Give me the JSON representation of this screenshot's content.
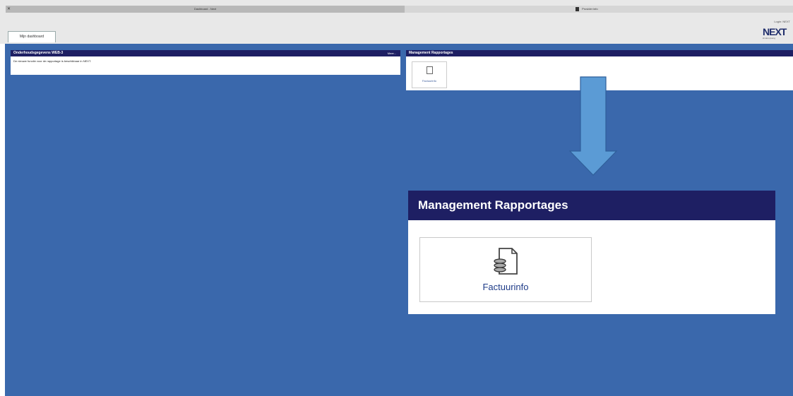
{
  "browser": {
    "active_tab_title": "Dashboard - Next",
    "close_label": "✕",
    "provider_label": "Provider info"
  },
  "header": {
    "user_info": "Login: NEXT",
    "dashboard_tab_label": "Mijn dashboard",
    "logo_text": "NEXT",
    "logo_subtitle": "kinderopvang"
  },
  "panel_left": {
    "title": "Onderhoudsgegevens WEB-3",
    "more_label": "Meer...",
    "message": "De nieuwe functie voor de rapportage is beschikbaar in NEXT."
  },
  "panel_right": {
    "title": "Management Rapportages",
    "tile_label": "Factuurinfo"
  },
  "zoom_callout": {
    "title": "Management Rapportages",
    "tile_label": "Factuurinfo",
    "icon": "invoice-document-icon"
  },
  "colors": {
    "background_blue": "#3a68ac",
    "header_navy": "#1e1f63",
    "arrow_blue": "#5b9bd5",
    "link_blue": "#1f3c88"
  }
}
